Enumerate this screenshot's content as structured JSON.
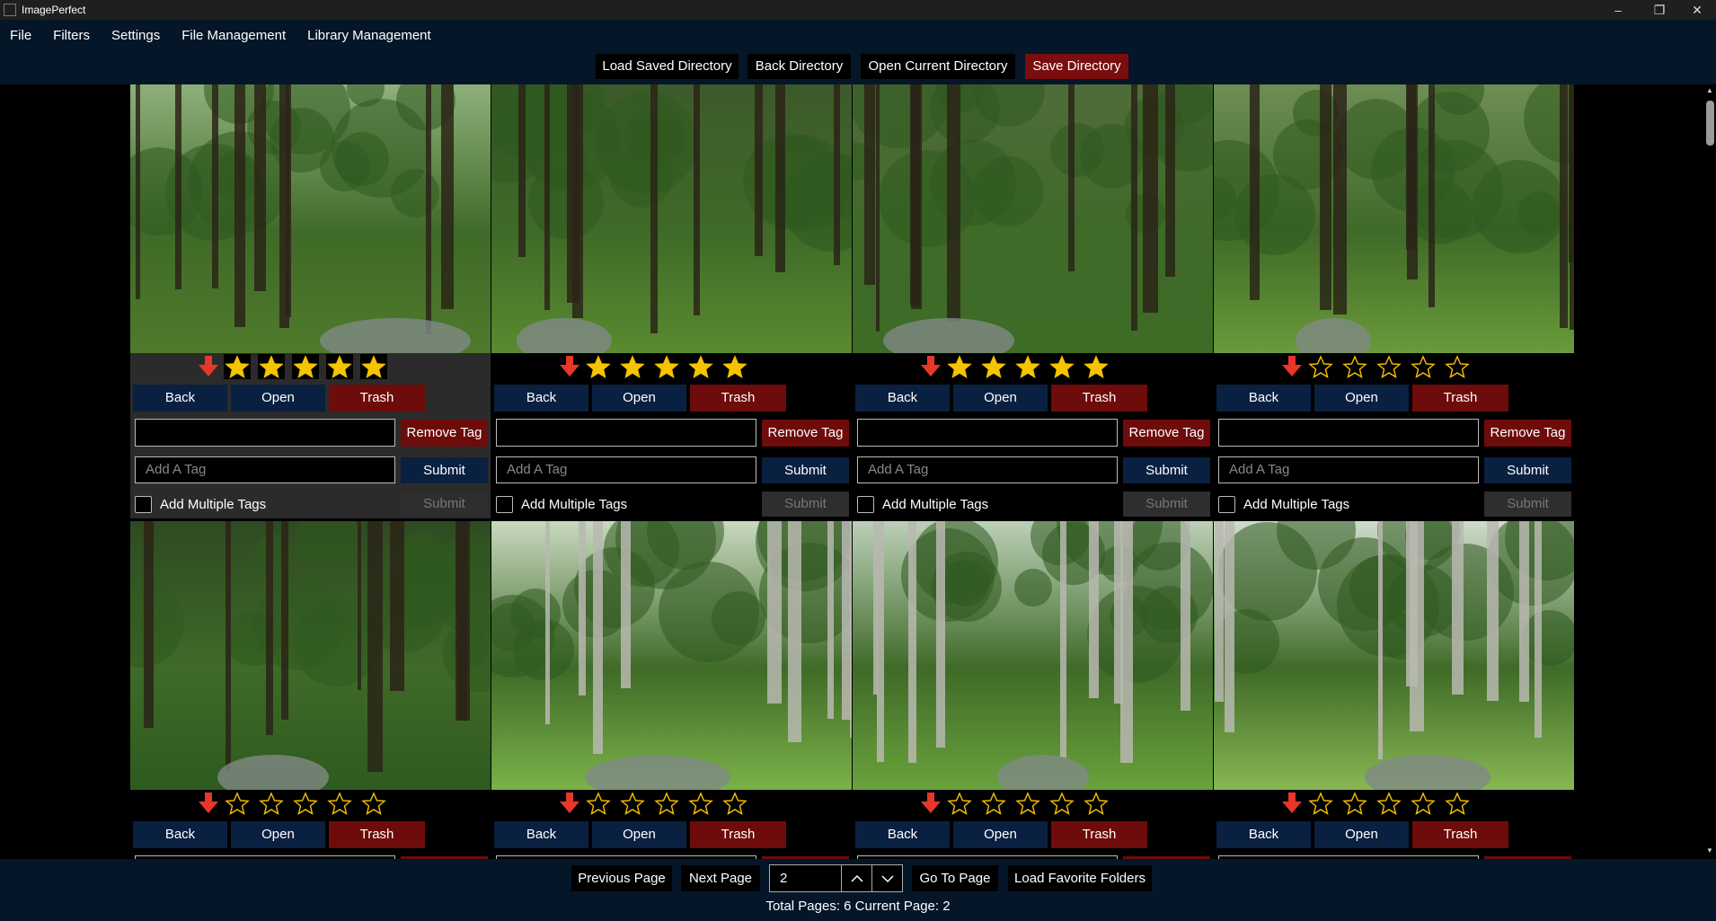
{
  "window": {
    "title": "ImagePerfect"
  },
  "menu": [
    "File",
    "Filters",
    "Settings",
    "File Management",
    "Library Management"
  ],
  "toolbar": {
    "load_saved": "Load Saved Directory",
    "back_dir": "Back Directory",
    "open_current": "Open Current Directory",
    "save_dir": "Save Directory"
  },
  "cell_labels": {
    "back": "Back",
    "open": "Open",
    "trash": "Trash",
    "remove_tag": "Remove Tag",
    "add_tag_placeholder": "Add A Tag",
    "submit": "Submit",
    "add_multiple": "Add Multiple Tags",
    "submit_multi": "Submit"
  },
  "images": [
    {
      "rating": 5,
      "selected": true
    },
    {
      "rating": 5,
      "selected": false
    },
    {
      "rating": 5,
      "selected": false
    },
    {
      "rating": 0,
      "selected": false
    },
    {
      "rating": 0,
      "selected": false
    },
    {
      "rating": 0,
      "selected": false
    },
    {
      "rating": 0,
      "selected": false
    },
    {
      "rating": 0,
      "selected": false
    }
  ],
  "icons": {
    "rating_clear": "red-down-arrow-icon",
    "star": "star-icon"
  },
  "colors": {
    "star": "#f5c300",
    "arrow": "#e8362a",
    "trash": "#6e0b0b",
    "nav": "#0a2040",
    "chrome": "#051628"
  },
  "pager": {
    "previous": "Previous Page",
    "next": "Next Page",
    "page_value": "2",
    "go_to": "Go To Page",
    "load_fav": "Load Favorite Folders",
    "info": "Total Pages: 6 Current Page: 2"
  }
}
